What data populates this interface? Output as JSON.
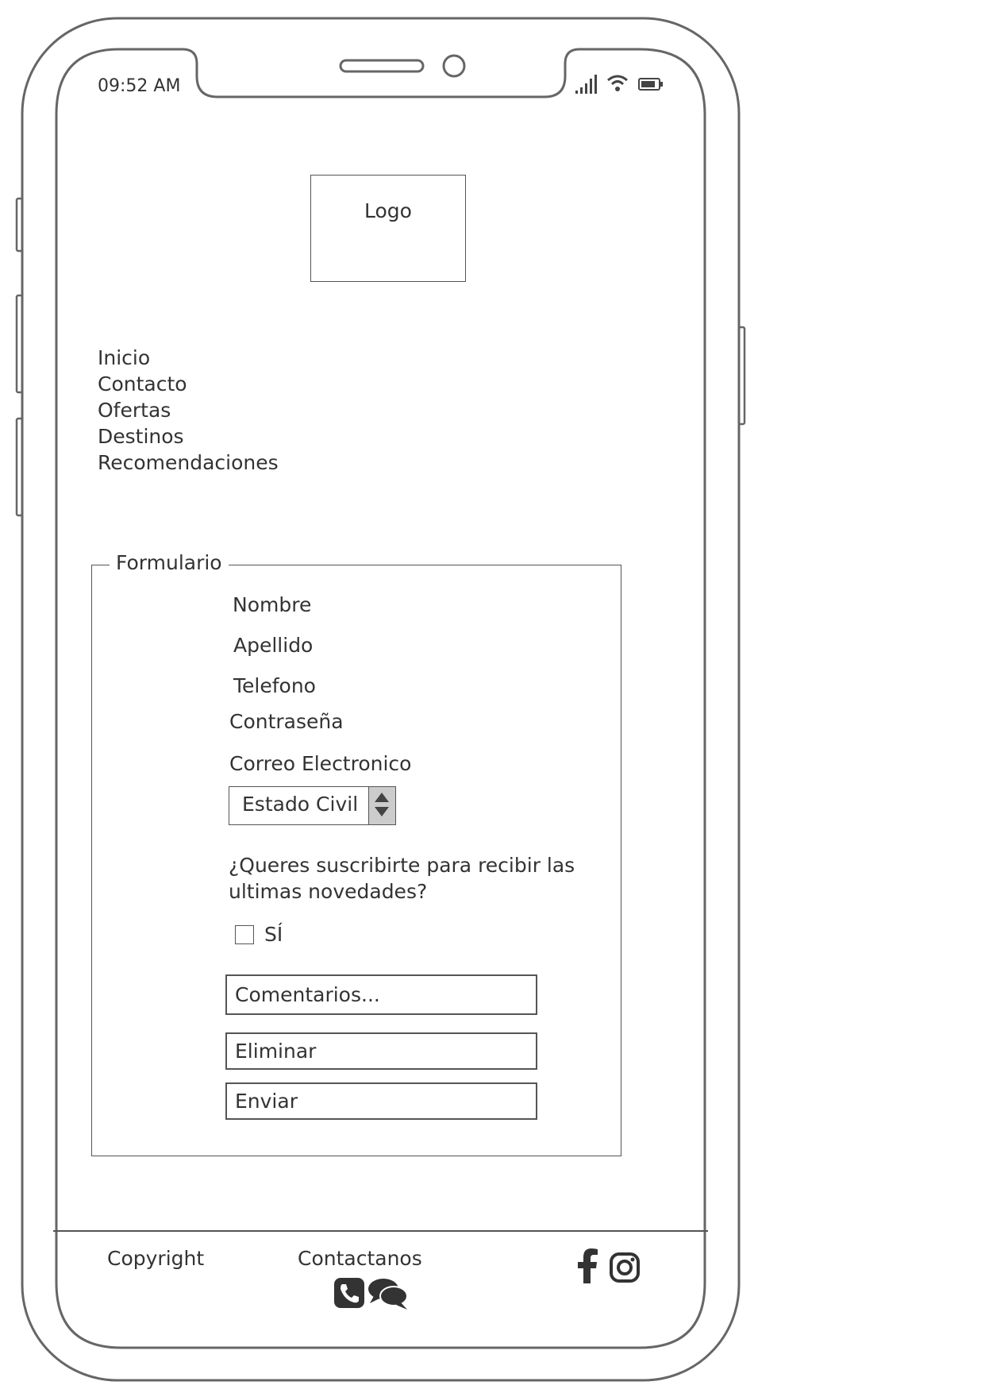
{
  "status_bar": {
    "time": "09:52 AM"
  },
  "header": {
    "logo_label": "Logo"
  },
  "nav": {
    "items": [
      "Inicio",
      "Contacto",
      "Ofertas",
      "Destinos",
      "Recomendaciones"
    ]
  },
  "form": {
    "legend": "Formulario",
    "fields": {
      "nombre": "Nombre",
      "apellido": "Apellido",
      "telefono": "Telefono",
      "password": "Contraseña",
      "email": "Correo Electronico"
    },
    "estado_civil": "Estado Civil",
    "subscribe_question_line1": "¿Queres suscribirte para recibir las",
    "subscribe_question_line2": "ultimas novedades?",
    "checkbox_label": "SÍ",
    "checkbox_checked": false,
    "comments_placeholder": "Comentarios...",
    "delete_label": "Eliminar",
    "submit_label": "Enviar"
  },
  "footer": {
    "copyright": "Copyright",
    "contact": "Contactanos",
    "icons": [
      "phone-icon",
      "chat-icon",
      "facebook-icon",
      "instagram-icon"
    ]
  },
  "colors": {
    "stroke": "#555555",
    "text": "#333333",
    "select_arrow_bg": "#cccccc"
  }
}
